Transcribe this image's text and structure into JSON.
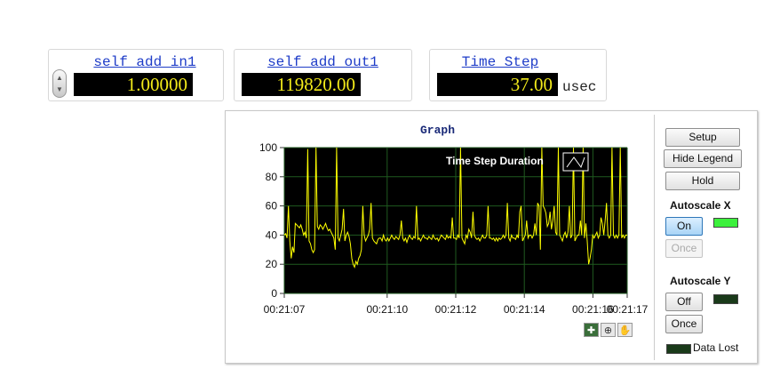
{
  "controls": [
    {
      "label": "self add in1",
      "value": "1.00000",
      "unit": ""
    },
    {
      "label": "self add out1",
      "value": "119820.00",
      "unit": ""
    },
    {
      "label": "Time Step",
      "value": "37.00",
      "unit": "usec"
    }
  ],
  "graph": {
    "title": "Graph",
    "buttons": {
      "setup": "Setup",
      "hide_legend": "Hide Legend",
      "hold": "Hold",
      "on": "On",
      "once": "Once",
      "off": "Off"
    },
    "autoscale_x_label": "Autoscale X",
    "autoscale_y_label": "Autoscale Y",
    "data_lost_label": "Data Lost",
    "colors": {
      "plot_bg": "#000000",
      "trace": "#ffff00",
      "grid": "#1f5a1f",
      "led_on": "#3cf13c",
      "led_off": "#1a3a1a"
    }
  },
  "chart_data": {
    "type": "line",
    "title": "Graph",
    "xlabel": "",
    "ylabel": "",
    "ylim": [
      0,
      100
    ],
    "xlim": [
      "00:21:07",
      "00:21:17"
    ],
    "x_ticks": [
      "00:21:07",
      "00:21:10",
      "00:21:12",
      "00:21:14",
      "00:21:16",
      "00:21:17"
    ],
    "y_ticks": [
      0,
      20,
      40,
      60,
      80,
      100
    ],
    "grid": true,
    "legend": "top-right",
    "series": [
      {
        "name": "Time Step Duration",
        "x_start": "00:21:07",
        "x_end": "00:21:17",
        "values": [
          40,
          41,
          38,
          60,
          36,
          24,
          32,
          28,
          48,
          47,
          46,
          45,
          47,
          44,
          40,
          42,
          38,
          99,
          36,
          34,
          30,
          28,
          30,
          100,
          46,
          44,
          47,
          46,
          44,
          46,
          48,
          45,
          43,
          44,
          42,
          40,
          38,
          30,
          100,
          38,
          36,
          40,
          44,
          58,
          36,
          40,
          42,
          39,
          34,
          24,
          20,
          18,
          22,
          20,
          24,
          26,
          30,
          60,
          40,
          36,
          38,
          40,
          44,
          62,
          38,
          36,
          35,
          34,
          37,
          38,
          38,
          36,
          40,
          37,
          36,
          38,
          36,
          38,
          40,
          38,
          37,
          39,
          38,
          37,
          40,
          50,
          38,
          36,
          38,
          35,
          38,
          40,
          38,
          37,
          39,
          38,
          60,
          37,
          38,
          36,
          38,
          40,
          38,
          38,
          37,
          39,
          38,
          37,
          40,
          38,
          37,
          38,
          36,
          38,
          40,
          39,
          38,
          37,
          40,
          38,
          39,
          38,
          52,
          38,
          38,
          37,
          40,
          38,
          100,
          38,
          36,
          34,
          40,
          38,
          44,
          42,
          38,
          56,
          40,
          38,
          37,
          38,
          36,
          38,
          40,
          38,
          38,
          40,
          60,
          38,
          38,
          37,
          38,
          36,
          38,
          36,
          38,
          37,
          38,
          40,
          38,
          40,
          62,
          38,
          36,
          40,
          38,
          38,
          37,
          40,
          38,
          56,
          60,
          36,
          38,
          40,
          50,
          38,
          40,
          40,
          38,
          40,
          48,
          40,
          62,
          60,
          30,
          100,
          60,
          58,
          55,
          46,
          48,
          56,
          44,
          50,
          60,
          42,
          40,
          100,
          40,
          38,
          36,
          40,
          42,
          38,
          42,
          60,
          38,
          40,
          100,
          36,
          38,
          40,
          40,
          50,
          40,
          100,
          38,
          48,
          36,
          20,
          24,
          30,
          40,
          38,
          40,
          42,
          38,
          40,
          52,
          48,
          40,
          50,
          62,
          40,
          38,
          40,
          100,
          40,
          38,
          40,
          38,
          40,
          100,
          38,
          40,
          38,
          40,
          40
        ]
      }
    ]
  }
}
